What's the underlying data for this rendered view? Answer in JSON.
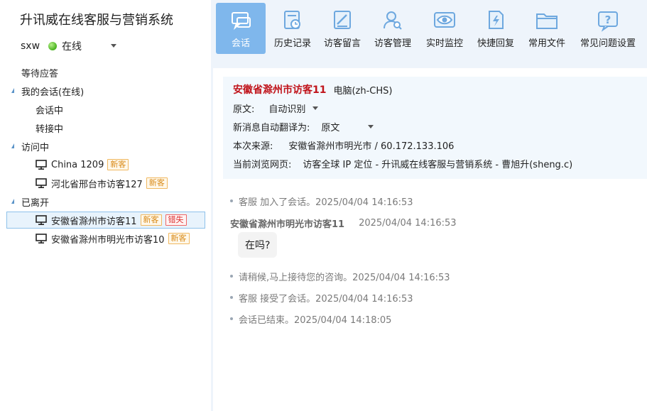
{
  "app": {
    "title": "升讯威在线客服与营销系统"
  },
  "user": {
    "name": "sxw",
    "status": "在线"
  },
  "tree": {
    "waiting": "等待应答",
    "my_sessions": "我的会话(在线)",
    "in_session": "会话中",
    "transferring": "转接中",
    "visiting": "访问中",
    "left": "已离开",
    "visitors_visiting": [
      {
        "name": "China 1209",
        "tag": "新客"
      },
      {
        "name": "河北省邢台市访客127",
        "tag": "新客"
      }
    ],
    "visitors_left": [
      {
        "name": "安徽省滁州市访客11",
        "tag": "新客",
        "tag2": "错失"
      },
      {
        "name": "安徽省滁州市明光市访客10",
        "tag": "新客"
      }
    ]
  },
  "toolbar": [
    {
      "label": "会话",
      "icon": "chat-icon"
    },
    {
      "label": "历史记录",
      "icon": "history-icon"
    },
    {
      "label": "访客留言",
      "icon": "message-edit-icon"
    },
    {
      "label": "访客管理",
      "icon": "user-search-icon"
    },
    {
      "label": "实时监控",
      "icon": "eye-icon"
    },
    {
      "label": "快捷回复",
      "icon": "quick-reply-icon"
    },
    {
      "label": "常用文件",
      "icon": "folder-icon"
    },
    {
      "label": "常见问题设置",
      "icon": "faq-icon"
    }
  ],
  "info": {
    "visitor_name": "安徽省滁州市访客11",
    "device": "电脑(zh-CHS)",
    "source_lang_label": "原文:",
    "source_lang_value": "自动识别",
    "translate_label": "新消息自动翻译为:",
    "translate_value": "原文",
    "origin_label": "本次来源:",
    "origin_value": "安徽省滁州市明光市  /  60.172.133.106",
    "page_label": "当前浏览网页:",
    "page_value": "访客全球 IP 定位 - 升讯威在线客服与营销系统 - 曹旭升(sheng.c)"
  },
  "messages": {
    "sys1": "客服 加入了会话。2025/04/04 14:16:53",
    "visitor_name": "安徽省滁州市明光市访客11",
    "visitor_time": "2025/04/04 14:16:53",
    "visitor_text": "在吗?",
    "sys2": "请稍候,马上接待您的咨询。2025/04/04 14:16:53",
    "sys3": "客服 接受了会话。2025/04/04 14:16:53",
    "sys4": "会话已结束。2025/04/04 14:18:05"
  },
  "colors": {
    "accent": "#7fb7ec",
    "visitor_name": "#c0141b",
    "tag_new": "#d98b1a",
    "tag_miss": "#dd3333"
  }
}
